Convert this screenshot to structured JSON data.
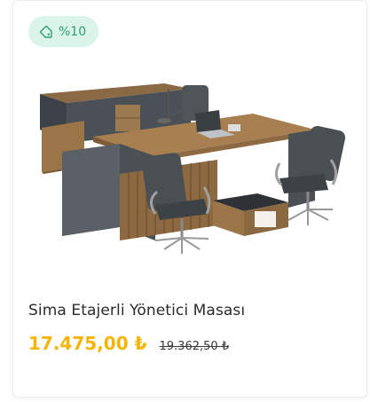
{
  "product": {
    "discount_badge": "%10",
    "title": "Sima Etajerli Yönetici Masası",
    "price": "17.475,00 ₺",
    "old_price": "19.362,50 ₺"
  },
  "icons": {
    "badge_icon": "price-tag-icon"
  },
  "colors": {
    "badge_bg": "#daf4ea",
    "badge_text": "#2f9e76",
    "price": "#f5b400"
  }
}
